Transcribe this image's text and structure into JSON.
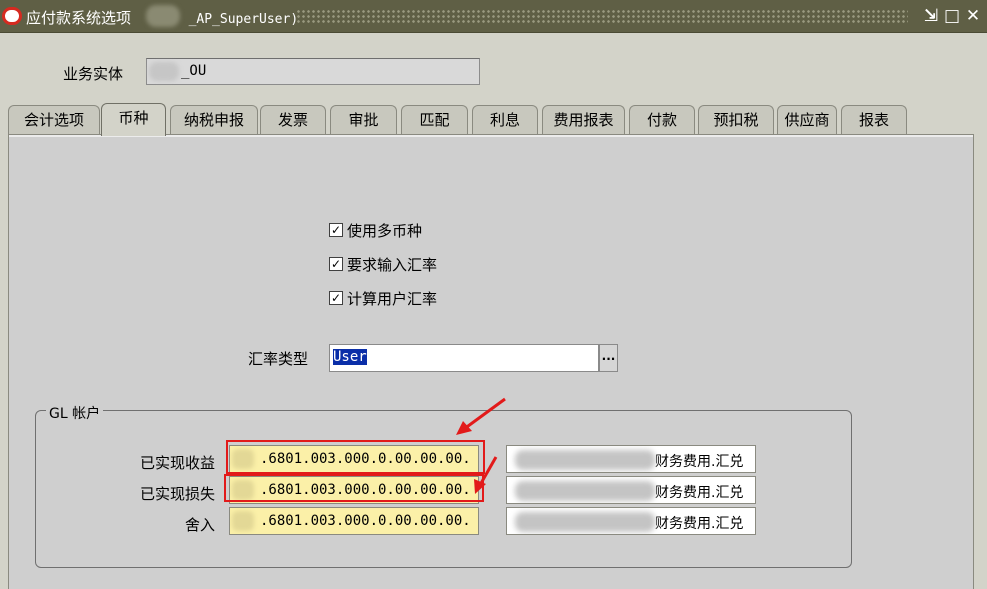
{
  "window": {
    "title": "应付款系统选项",
    "title_responsibility": "_AP_SuperUser)",
    "controls": [
      "minimize-icon",
      "maximize-icon",
      "close-icon"
    ]
  },
  "header": {
    "operating_unit_label": "业务实体",
    "operating_unit_value": "_OU"
  },
  "tabs": [
    {
      "label": "会计选项",
      "active": false
    },
    {
      "label": "币种",
      "active": true
    },
    {
      "label": "纳税申报",
      "active": false
    },
    {
      "label": "发票",
      "active": false
    },
    {
      "label": "审批",
      "active": false
    },
    {
      "label": "匹配",
      "active": false
    },
    {
      "label": "利息",
      "active": false
    },
    {
      "label": "费用报表",
      "active": false
    },
    {
      "label": "付款",
      "active": false
    },
    {
      "label": "预扣税",
      "active": false
    },
    {
      "label": "供应商",
      "active": false
    },
    {
      "label": "报表",
      "active": false
    }
  ],
  "currency": {
    "checkboxes": [
      {
        "label": "使用多币种",
        "checked": true
      },
      {
        "label": "要求输入汇率",
        "checked": true
      },
      {
        "label": "计算用户汇率",
        "checked": true
      }
    ],
    "rate_type_label": "汇率类型",
    "rate_type_value": "User",
    "lov_button": "..."
  },
  "gl_accounts": {
    "group_title": "GL 帐户",
    "rows": [
      {
        "label": "已实现收益",
        "account": ".6801.003.000.0.00.00.00.",
        "description": "财务费用.汇兑",
        "highlighted": true
      },
      {
        "label": "已实现损失",
        "account": ".6801.003.000.0.00.00.00.",
        "description": "财务费用.汇兑",
        "highlighted": true
      },
      {
        "label": "舍入",
        "account": ".6801.003.000.0.00.00.00.",
        "description": "财务费用.汇兑",
        "highlighted": false
      }
    ]
  },
  "colors": {
    "titlebar": "#5f5f45",
    "panel": "#d3d3c9",
    "account_field": "#fbf0a8",
    "highlight": "#e21a1a",
    "selection": "#0a2ea8"
  }
}
